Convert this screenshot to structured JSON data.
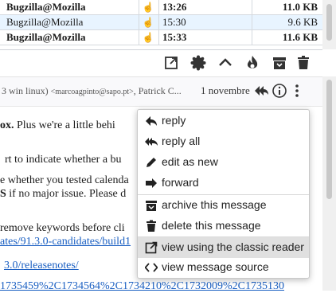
{
  "message_list": {
    "rows": [
      {
        "sender": "Bugzilla@Mozilla",
        "date": "13:26",
        "size": "11.0 KB",
        "bold": true,
        "selected": false
      },
      {
        "sender": "Bugzilla@Mozilla",
        "date": "15:30",
        "size": "9.6 KB",
        "bold": false,
        "selected": true
      },
      {
        "sender": "Bugzilla@Mozilla",
        "date": "15:33",
        "size": "11.6 KB",
        "bold": true,
        "selected": false
      }
    ]
  },
  "toolbar": {
    "buttons": [
      "open-in-new-icon",
      "flower-icon",
      "chevron-up-icon",
      "flame-icon",
      "archive-icon",
      "trash-icon"
    ]
  },
  "header": {
    "recipients_prefix": "3 win linux)",
    "recipients_addr": "<marcoagpinto@sapo.pt>",
    "recipients_suffix": ", Patrick C...",
    "date": "1 novembre"
  },
  "body": {
    "line1_bold": "ox.",
    "line1_rest": "  Plus we're a little behi",
    "line2": "rt to indicate whether a bu",
    "line3": "e whether you tested calenda",
    "line4_bold": "S",
    "line4_rest": " if no major issue.  Please d",
    "line5": " remove keywords before cli",
    "line6_link": "ates/91.3.0-candidates/build1",
    "line7_link": "3.0/releasenotes/",
    "line8_link": "1735459%2C1734564%2C1734210%2C1732009%2C1735130"
  },
  "context_menu": {
    "items": [
      {
        "label": "reply",
        "icon": "reply-icon"
      },
      {
        "label": "reply all",
        "icon": "reply-all-icon"
      },
      {
        "label": "edit as new",
        "icon": "pencil-icon"
      },
      {
        "label": "forward",
        "icon": "forward-icon"
      },
      {
        "label": "archive this message",
        "icon": "archive-icon"
      },
      {
        "label": "delete this message",
        "icon": "trash-icon"
      },
      {
        "label": "view using the classic reader",
        "icon": "open-in-new-icon",
        "highlighted": true
      },
      {
        "label": "view message source",
        "icon": "code-icon"
      }
    ]
  }
}
